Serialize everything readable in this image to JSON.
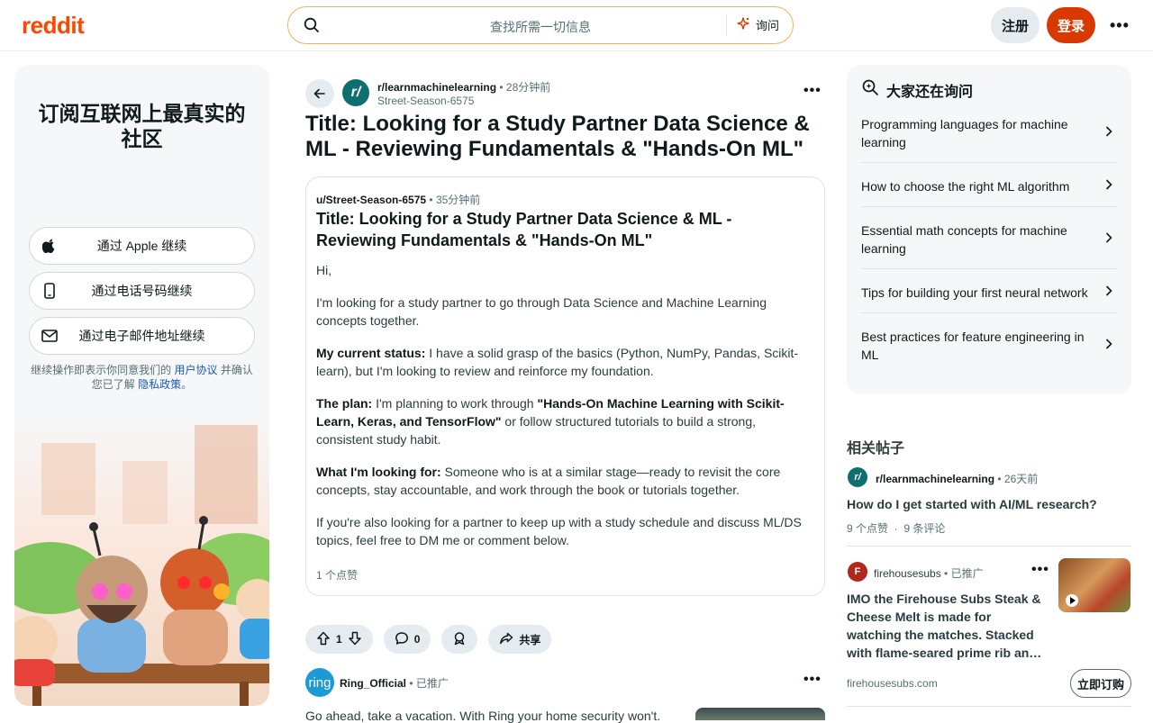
{
  "header": {
    "logo": "reddit",
    "search_placeholder": "查找所需一切信息",
    "ask_label": "询问",
    "signup_label": "注册",
    "login_label": "登录"
  },
  "sidebar": {
    "headline": "订阅互联网上最真实的社区",
    "apple_label": "通过 Apple 继续",
    "phone_label": "通过电话号码继续",
    "email_label": "通过电子邮件地址继续",
    "terms_prefix": "继续操作即表示你同意我们的",
    "terms_link": "用户协议",
    "terms_mid": "并确认您已了解",
    "privacy_link": "隐私政策",
    "terms_suffix": "。"
  },
  "post": {
    "subreddit": "r/learnmachinelearning",
    "time": "28分钟前",
    "author": "Street-Season-6575",
    "title": "Title: Looking for a Study Partner Data Science & ML - Reviewing Fundamentals & \"Hands-On ML\"",
    "card": {
      "author": "u/Street-Season-6575",
      "time": "35分钟前",
      "title": "Title: Looking for a Study Partner Data Science & ML - Reviewing Fundamentals & \"Hands-On ML\"",
      "p1": "Hi,",
      "p2": "I'm looking for a study partner to go through Data Science and Machine Learning concepts together.",
      "p3_bold": "My current status:",
      "p3": " I have a solid grasp of the basics (Python, NumPy, Pandas, Scikit-learn), but I'm looking to review and reinforce my foundation.",
      "p4_bold": "The plan:",
      "p4_a": " I'm planning to work through ",
      "p4_bold2": "\"Hands-On Machine Learning with Scikit-Learn, Keras, and TensorFlow\"",
      "p4_b": " or follow structured tutorials to build a strong, consistent study habit.",
      "p5_bold": "What I'm looking for:",
      "p5": " Someone who is at a similar stage—ready to revisit the core concepts, stay accountable, and work through the book or tutorials together.",
      "p6": "If you're also looking for a partner to keep up with a study schedule and discuss ML/DS topics, feel free to DM me or comment below.",
      "upvotes_label": "1 个点赞"
    },
    "vote_count": "1",
    "comment_count": "0",
    "share_label": "共享"
  },
  "ad": {
    "name": "Ring_Official",
    "avatar_text": "ring",
    "promoted": "已推广",
    "text": "Go ahead, take a vacation. With Ring your home security won't."
  },
  "ask_panel": {
    "title": "大家还在询问",
    "items": [
      "Programming languages for machine learning",
      "How to choose the right ML algorithm",
      "Essential math concepts for machine learning",
      "Tips for building your first neural network",
      "Best practices for feature engineering in ML"
    ]
  },
  "related": {
    "title": "相关帖子",
    "post1": {
      "subreddit": "r/learnmachinelearning",
      "time": "26天前",
      "title": "How do I get started with AI/ML research?",
      "likes": "9 个点赞",
      "comments": "9 条评论"
    },
    "post2": {
      "name": "firehousesubs",
      "promoted": "已推广",
      "title": "IMO the Firehouse Subs Steak & Cheese Melt is made for watching the matches. Stacked with flame-seared prime rib an…",
      "domain": "firehousesubs.com",
      "subscribe_label": "立即订购"
    }
  },
  "colors": {
    "brand": "#ff4500",
    "login": "#d93900",
    "link": "#1a5ab4"
  }
}
